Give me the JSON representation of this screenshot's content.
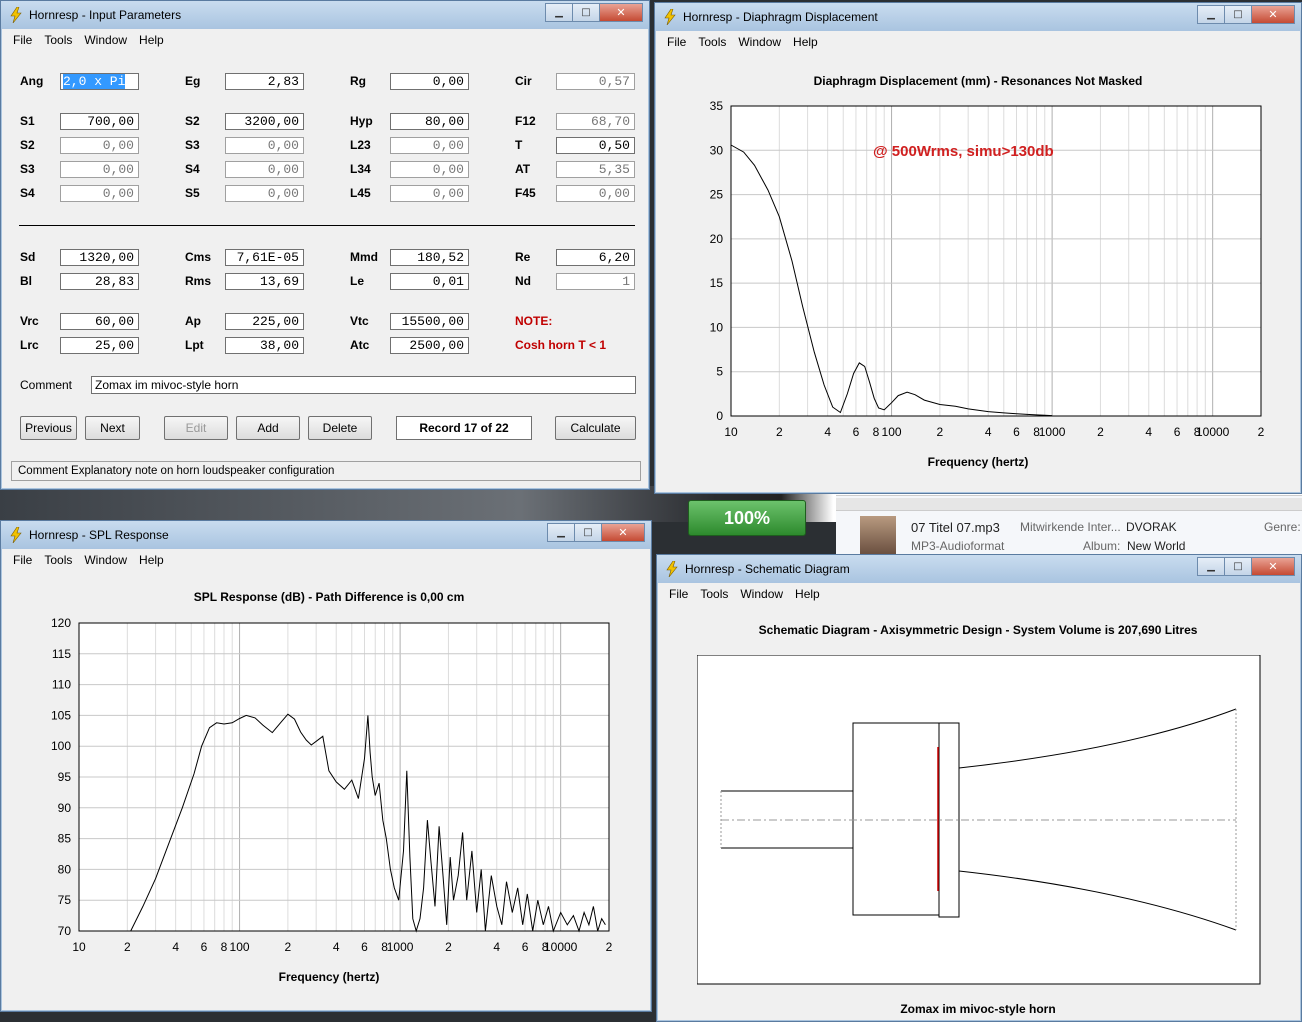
{
  "menu": [
    "File",
    "Tools",
    "Window",
    "Help"
  ],
  "input_window": {
    "title": "Hornresp - Input Parameters",
    "fields": [
      {
        "label": "Ang",
        "value": "2,0 x Pi",
        "selected": true
      },
      {
        "label": "Eg",
        "value": "2,83"
      },
      {
        "label": "Rg",
        "value": "0,00"
      },
      {
        "label": "Cir",
        "value": "0,57",
        "readonly": true
      },
      {
        "label": "S1",
        "value": "700,00"
      },
      {
        "label": "S2",
        "value": "3200,00"
      },
      {
        "label": "Hyp",
        "value": "80,00"
      },
      {
        "label": "F12",
        "value": "68,70",
        "readonly": true
      },
      {
        "label": "S2",
        "value": "0,00",
        "readonly": true
      },
      {
        "label": "S3",
        "value": "0,00",
        "readonly": true
      },
      {
        "label": "L23",
        "value": "0,00",
        "readonly": true
      },
      {
        "label": "T",
        "value": "0,50"
      },
      {
        "label": "S3",
        "value": "0,00",
        "readonly": true
      },
      {
        "label": "S4",
        "value": "0,00",
        "readonly": true
      },
      {
        "label": "L34",
        "value": "0,00",
        "readonly": true
      },
      {
        "label": "AT",
        "value": "5,35",
        "readonly": true
      },
      {
        "label": "S4",
        "value": "0,00",
        "readonly": true
      },
      {
        "label": "S5",
        "value": "0,00",
        "readonly": true
      },
      {
        "label": "L45",
        "value": "0,00",
        "readonly": true
      },
      {
        "label": "F45",
        "value": "0,00",
        "readonly": true
      },
      {
        "label": "Sd",
        "value": "1320,00"
      },
      {
        "label": "Cms",
        "value": "7,61E-05"
      },
      {
        "label": "Mmd",
        "value": "180,52"
      },
      {
        "label": "Re",
        "value": "6,20"
      },
      {
        "label": "Bl",
        "value": "28,83"
      },
      {
        "label": "Rms",
        "value": "13,69"
      },
      {
        "label": "Le",
        "value": "0,01"
      },
      {
        "label": "Nd",
        "value": "1",
        "readonly": true
      },
      {
        "label": "Vrc",
        "value": "60,00"
      },
      {
        "label": "Ap",
        "value": "225,00"
      },
      {
        "label": "Vtc",
        "value": "15500,00"
      },
      {
        "label": "Lrc",
        "value": "25,00"
      },
      {
        "label": "Lpt",
        "value": "38,00"
      },
      {
        "label": "Atc",
        "value": "2500,00"
      }
    ],
    "note_label": "NOTE:",
    "note_text": "Cosh horn  T < 1",
    "comment_label": "Comment",
    "comment_value": "Zomax im mivoc-style horn",
    "buttons": {
      "previous": "Previous",
      "next": "Next",
      "edit": "Edit",
      "add": "Add",
      "delete": "Delete",
      "calculate": "Calculate"
    },
    "record": "Record 17 of 22",
    "status": "Comment   Explanatory note on horn loudspeaker configuration"
  },
  "disp_window": {
    "title": "Hornresp - Diaphragm Displacement",
    "annotation": "@ 500Wrms, simu>130db"
  },
  "spl_window": {
    "title": "Hornresp - SPL Response"
  },
  "schem_window": {
    "title": "Hornresp - Schematic Diagram",
    "chart_title": "Schematic Diagram - Axisymmetric Design - System Volume is 207,690 Litres",
    "caption": "Zomax im mivoc-style horn"
  },
  "background": {
    "media_title": "07 Titel 07.mp3",
    "media_format": "MP3-Audioformat",
    "contrib_label": "Mitwirkende Inter...",
    "contrib_value": "DVORAK",
    "album_label": "Album:",
    "album_value": "New World",
    "genre_label": "Genre:",
    "battery": "100%"
  },
  "colors": {
    "accent_red": "#cc0000",
    "note_red": "#c00000",
    "selection": "#3399ff"
  },
  "chart_data": [
    {
      "type": "line",
      "title": "Diaphragm Displacement (mm) - Resonances Not Masked",
      "xlabel": "Frequency (hertz)",
      "ylabel": "",
      "xscale": "log",
      "xlim": [
        10,
        20000
      ],
      "ylim": [
        0,
        35
      ],
      "yticks": [
        0,
        5,
        10,
        15,
        20,
        25,
        30,
        35
      ],
      "xticklabels": [
        "10",
        "2",
        "4",
        "6",
        "8",
        "100",
        "2",
        "4",
        "6",
        "8",
        "1000",
        "2",
        "4",
        "6",
        "8",
        "10000",
        "2"
      ],
      "x": [
        10,
        12,
        14,
        17,
        20,
        24,
        28,
        33,
        38,
        43,
        48,
        53,
        58,
        63,
        68,
        73,
        78,
        83,
        90,
        100,
        110,
        125,
        140,
        160,
        200,
        250,
        300,
        400,
        500,
        600,
        700,
        800,
        900,
        1000
      ],
      "values": [
        30.6,
        29.8,
        28.3,
        25.5,
        22.5,
        17.5,
        12.3,
        7.2,
        3.5,
        1.0,
        0.4,
        2.5,
        4.8,
        6.0,
        5.6,
        3.8,
        2.0,
        0.9,
        0.7,
        1.5,
        2.3,
        2.7,
        2.4,
        1.8,
        1.3,
        1.1,
        0.8,
        0.5,
        0.35,
        0.25,
        0.18,
        0.12,
        0.08,
        0.05
      ],
      "series": [
        {
          "name": "",
          "values": []
        }
      ],
      "grid": true
    },
    {
      "type": "line",
      "title": "SPL Response (dB) - Path Difference is 0,00 cm",
      "xlabel": "Frequency (hertz)",
      "ylabel": "",
      "xscale": "log",
      "xlim": [
        10,
        20000
      ],
      "ylim": [
        70,
        120
      ],
      "yticks": [
        70,
        75,
        80,
        85,
        90,
        95,
        100,
        105,
        110,
        115,
        120
      ],
      "xticklabels": [
        "10",
        "2",
        "4",
        "6",
        "8",
        "100",
        "2",
        "4",
        "6",
        "8",
        "1000",
        "2",
        "4",
        "6",
        "8",
        "10000",
        "2"
      ],
      "x": [
        21,
        25,
        30,
        36,
        44,
        52,
        58,
        65,
        72,
        80,
        90,
        100,
        110,
        125,
        140,
        160,
        180,
        200,
        220,
        240,
        260,
        280,
        300,
        330,
        360,
        400,
        450,
        500,
        550,
        600,
        630,
        650,
        670,
        700,
        740,
        780,
        820,
        870,
        920,
        980,
        1050,
        1100,
        1150,
        1200,
        1260,
        1330,
        1400,
        1480,
        1560,
        1650,
        1750,
        1850,
        1950,
        2050,
        2150,
        2300,
        2450,
        2600,
        2800,
        3000,
        3200,
        3400,
        3700,
        4000,
        4300,
        4600,
        5000,
        5400,
        5800,
        6200,
        6700,
        7200,
        7800,
        8400,
        9000,
        10000,
        11000,
        12000,
        13000,
        14000,
        15000,
        16000,
        17000,
        18000,
        19000
      ],
      "values": [
        70,
        74,
        78.5,
        84,
        90,
        95.5,
        100,
        103,
        103.8,
        103.6,
        103.8,
        104.5,
        105,
        104.6,
        103.4,
        102.2,
        103.8,
        105.2,
        104.4,
        102.3,
        101,
        100.2,
        100.8,
        101.6,
        96,
        94.2,
        93,
        94.5,
        91.5,
        98,
        105,
        99,
        95,
        92,
        94,
        88,
        85,
        80,
        77,
        75,
        83,
        96,
        82,
        72,
        70,
        72,
        77,
        88,
        81,
        74,
        87,
        79,
        71,
        82,
        75,
        79,
        86,
        75,
        83,
        73,
        80,
        70,
        79,
        74,
        71,
        78,
        73,
        77,
        71,
        76,
        70,
        75,
        71,
        74,
        70,
        73,
        71,
        72.5,
        70,
        73,
        71,
        74,
        70,
        72,
        71
      ],
      "series": [
        {
          "name": "",
          "values": []
        }
      ],
      "grid": true
    }
  ]
}
